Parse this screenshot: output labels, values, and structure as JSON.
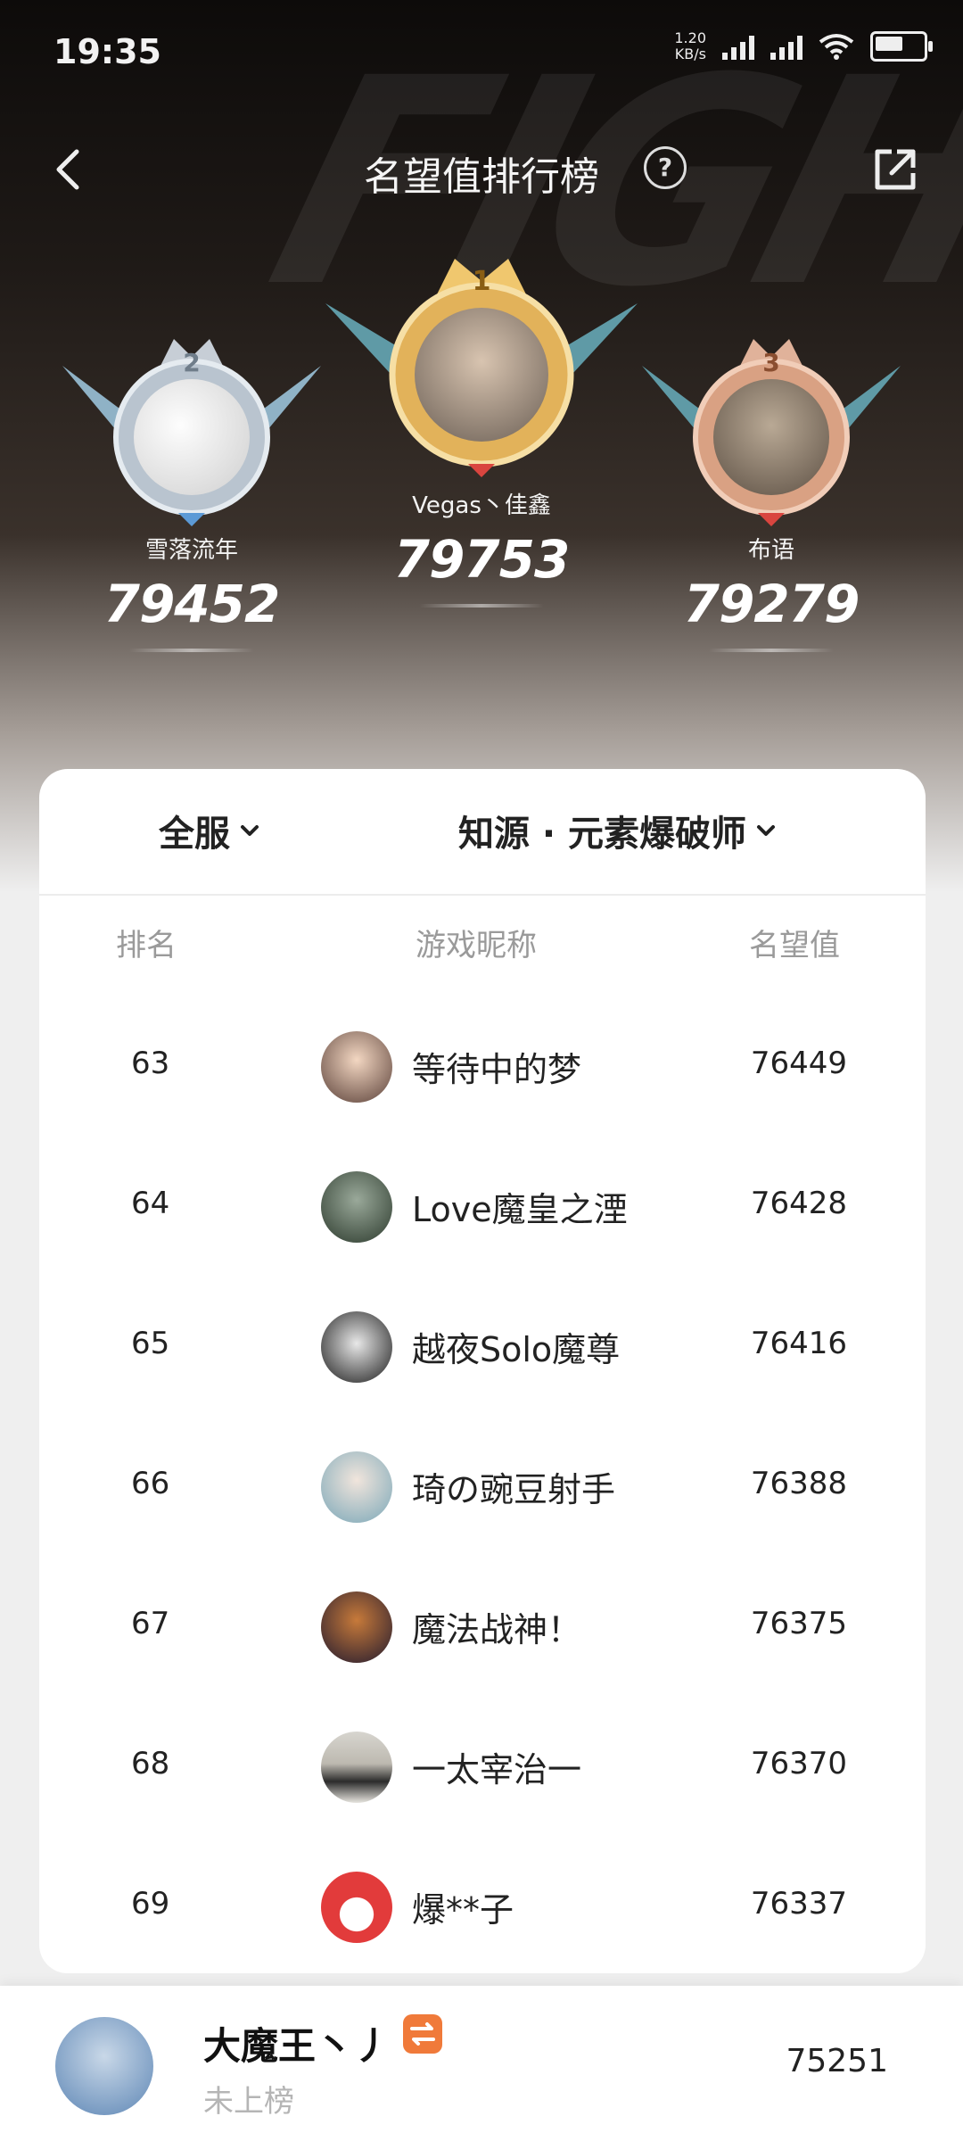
{
  "status_bar": {
    "time": "19:35",
    "speed_value": "1.20",
    "speed_unit": "KB/s",
    "icons": [
      "signal-icon",
      "hd-signal-icon",
      "wifi-icon",
      "battery-icon"
    ]
  },
  "nav": {
    "title": "名望值排行榜",
    "help_symbol": "?",
    "icons": [
      "back-icon",
      "help-icon",
      "share-icon"
    ]
  },
  "podium": [
    {
      "rank": "2",
      "name": "雪落流年",
      "score": "79452",
      "medal_color": "#b9c4cf"
    },
    {
      "rank": "1",
      "name": "Vegas丶佳鑫",
      "score": "79753",
      "medal_color": "#e2b25a"
    },
    {
      "rank": "3",
      "name": "布语",
      "score": "79279",
      "medal_color": "#d9a183"
    }
  ],
  "filters": {
    "server": "全服",
    "class": "知源 · 元素爆破师"
  },
  "table": {
    "headers": [
      "排名",
      "游戏昵称",
      "名望值"
    ],
    "rows": [
      {
        "rank": "63",
        "name": "等待中的梦",
        "value": "76449"
      },
      {
        "rank": "64",
        "name": "Love魔皇之湮",
        "value": "76428"
      },
      {
        "rank": "65",
        "name": "越夜Solo魔尊",
        "value": "76416"
      },
      {
        "rank": "66",
        "name": "琦の豌豆射手",
        "value": "76388"
      },
      {
        "rank": "67",
        "name": "魔法战神！",
        "value": "76375"
      },
      {
        "rank": "68",
        "name": "一太宰治一",
        "value": "76370"
      },
      {
        "rank": "69",
        "name": "爆**子",
        "value": "76337"
      }
    ]
  },
  "me": {
    "name": "大魔王丶丿",
    "status": "未上榜",
    "value": "75251"
  },
  "colors": {
    "accent_orange": "#f07a3a",
    "gold": "#e2b25a",
    "silver": "#b9c4cf",
    "bronze": "#d9a183"
  }
}
